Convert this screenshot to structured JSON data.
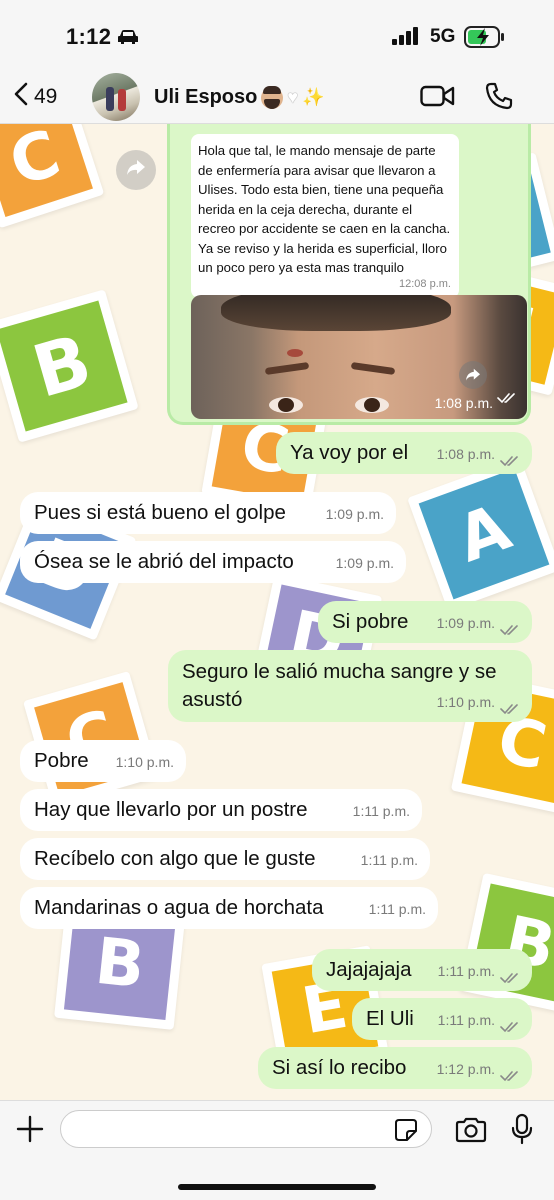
{
  "status": {
    "time": "1:12",
    "network": "5G"
  },
  "header": {
    "back_count": "49",
    "contact_name": "Uli Esposo",
    "emoji": [
      "bearded-man",
      "white-heart",
      "sparkles"
    ]
  },
  "forwarded": {
    "text": "Hola que tal, le mando mensaje de parte de enfermería para avisar que llevaron a Ulises. Todo esta bien, tiene una pequeña herida en la ceja derecha, durante el recreo por accidente se caen en la cancha. Ya se reviso y la herida es superficial, lloro un poco pero ya esta mas tranquilo",
    "text_time": "12:08 p.m.",
    "photo_time": "1:08 p.m."
  },
  "messages": [
    {
      "text": "Ya voy por el",
      "time": "1:08 p.m.",
      "dir": "out"
    },
    {
      "text": "Pues si está bueno el golpe",
      "time": "1:09 p.m.",
      "dir": "in"
    },
    {
      "text": "Ósea se le abrió del impacto",
      "time": "1:09 p.m.",
      "dir": "in"
    },
    {
      "text": "Si pobre",
      "time": "1:09 p.m.",
      "dir": "out"
    },
    {
      "text": "Seguro le salió mucha sangre y se asustó",
      "time": "1:10 p.m.",
      "dir": "out"
    },
    {
      "text": "Pobre",
      "time": "1:10 p.m.",
      "dir": "in"
    },
    {
      "text": "Hay que llevarlo por un postre",
      "time": "1:11 p.m.",
      "dir": "in"
    },
    {
      "text": "Recíbelo con algo que le guste",
      "time": "1:11 p.m.",
      "dir": "in"
    },
    {
      "text": "Mandarinas o agua de horchata",
      "time": "1:11 p.m.",
      "dir": "in"
    },
    {
      "text": "Jajajajaja",
      "time": "1:11 p.m.",
      "dir": "out"
    },
    {
      "text": "El Uli",
      "time": "1:11 p.m.",
      "dir": "out"
    },
    {
      "text": "Si así lo recibo",
      "time": "1:12 p.m.",
      "dir": "out"
    }
  ],
  "wallpaper_tiles": [
    "A",
    "B",
    "C",
    "D",
    "E"
  ],
  "colors": {
    "incoming_bubble": "#ffffff",
    "outgoing_bubble": "#dbf7c8",
    "chat_background": "#fbf4e6",
    "read_ticks": "#8a8a8a",
    "tile_green": "#8cc63f",
    "tile_blue": "#4aa3c8",
    "tile_orange": "#f3a23b",
    "tile_purple": "#9d95cc",
    "tile_yellow": "#f5b916"
  },
  "input": {
    "placeholder": "",
    "value": ""
  }
}
